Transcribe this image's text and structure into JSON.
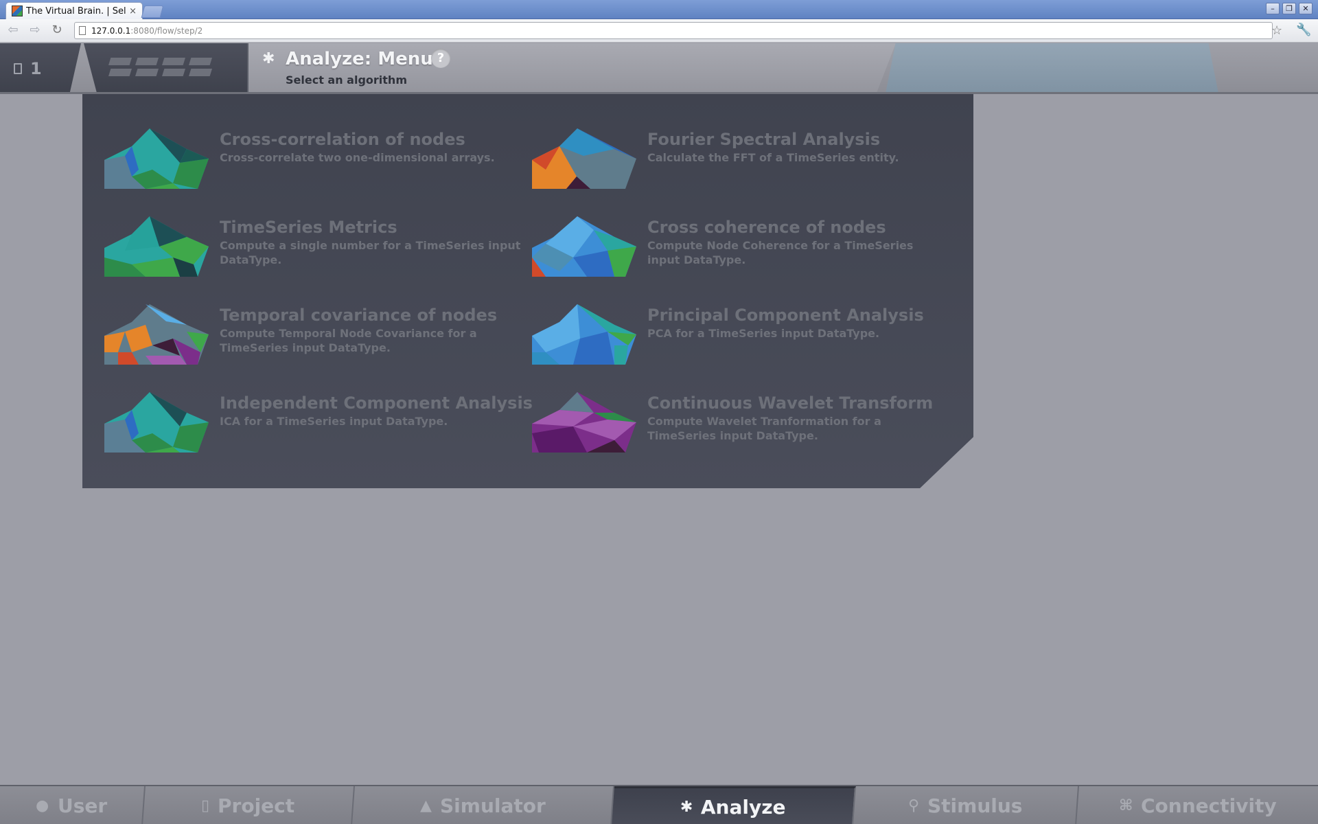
{
  "browser": {
    "tab_title": "The Virtual Brain. | Sele",
    "tab_close": "×",
    "url_host": "127.0.0.1",
    "url_path": ":8080/flow/step/2",
    "window_controls": [
      "–",
      "❐",
      "✕"
    ]
  },
  "header": {
    "project_count": "1",
    "title": "Analyze: Menu",
    "help_label": "?",
    "subtitle": "Select an algorithm"
  },
  "algorithms": [
    {
      "title": "Cross-correlation of nodes",
      "description": "Cross-correlate two one-dimensional arrays.",
      "icon": "algo-cross-correlation-icon"
    },
    {
      "title": "Fourier Spectral Analysis",
      "description": "Calculate the FFT of a TimeSeries entity.",
      "icon": "algo-fourier-icon"
    },
    {
      "title": "TimeSeries Metrics",
      "description": "Compute a single number for a TimeSeries input DataType.",
      "icon": "algo-timeseries-metrics-icon"
    },
    {
      "title": "Cross coherence of nodes",
      "description": "Compute Node Coherence for a TimeSeries input DataType.",
      "icon": "algo-cross-coherence-icon"
    },
    {
      "title": "Temporal covariance of nodes",
      "description": "Compute Temporal Node Covariance for a TimeSeries input DataType.",
      "icon": "algo-temporal-covariance-icon"
    },
    {
      "title": "Principal Component Analysis",
      "description": "PCA for a TimeSeries input DataType.",
      "icon": "algo-pca-icon"
    },
    {
      "title": "Independent Component Analysis",
      "description": "ICA for a TimeSeries input DataType.",
      "icon": "algo-ica-icon"
    },
    {
      "title": "Continuous Wavelet Transform",
      "description": "Compute Wavelet Tranformation for a TimeSeries input DataType.",
      "icon": "algo-wavelet-icon"
    }
  ],
  "bottom_nav": [
    {
      "label": "User",
      "icon": "user-icon"
    },
    {
      "label": "Project",
      "icon": "document-icon"
    },
    {
      "label": "Simulator",
      "icon": "rocket-icon"
    },
    {
      "label": "Analyze",
      "icon": "gear-icon",
      "active": true
    },
    {
      "label": "Stimulus",
      "icon": "pin-icon"
    },
    {
      "label": "Connectivity",
      "icon": "connectivity-icon"
    }
  ],
  "colors": {
    "panel_bg": "#444753",
    "active_tab_bg": "#40434f",
    "muted_text": "#6d7079",
    "green": "#3fa84a",
    "teal": "#2aa6a0",
    "blue": "#3d8ed6",
    "orange": "#e5852a",
    "purple": "#7c2e8a"
  }
}
